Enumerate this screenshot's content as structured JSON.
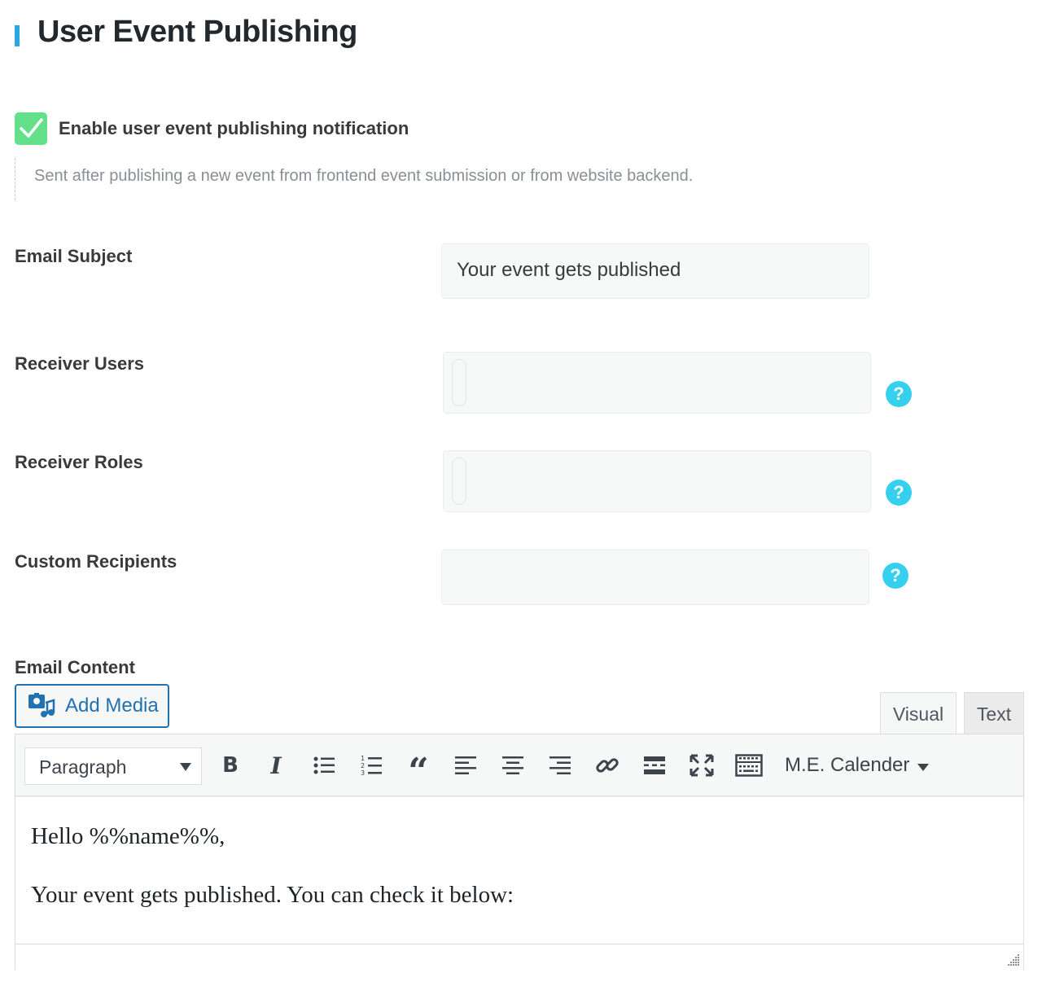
{
  "section": {
    "title": "User Event Publishing",
    "accent_color": "#28a8e0"
  },
  "enable": {
    "label": "Enable user event publishing notification",
    "checked": true,
    "check_color": "#64e08a",
    "description": "Sent after publishing a new event from frontend event submission or from website backend."
  },
  "fields": {
    "email_subject": {
      "label": "Email Subject",
      "value": "Your event gets published"
    },
    "receiver_users": {
      "label": "Receiver Users",
      "value": ""
    },
    "receiver_roles": {
      "label": "Receiver Roles",
      "value": ""
    },
    "custom_recipients": {
      "label": "Custom Recipients",
      "value": ""
    },
    "help_glyph": "?",
    "help_color": "#36d0ef"
  },
  "email_content": {
    "label": "Email Content",
    "add_media_label": "Add Media",
    "tabs": [
      {
        "label": "Visual",
        "active": true
      },
      {
        "label": "Text",
        "active": false
      }
    ],
    "toolbar": {
      "format_value": "Paragraph",
      "bold_glyph": "B",
      "italic_glyph": "I",
      "quote_glyph": "“",
      "icons": [
        "bold-icon",
        "italic-icon",
        "bullet-list-icon",
        "numbered-list-icon",
        "blockquote-icon",
        "align-left-icon",
        "align-center-icon",
        "align-right-icon",
        "link-icon",
        "read-more-icon",
        "fullscreen-icon",
        "toolbar-toggle-icon"
      ],
      "calendar_menu_label": "M.E. Calender"
    },
    "body_lines": [
      "Hello %%name%%,",
      "Your event gets published. You can check it below:"
    ]
  }
}
